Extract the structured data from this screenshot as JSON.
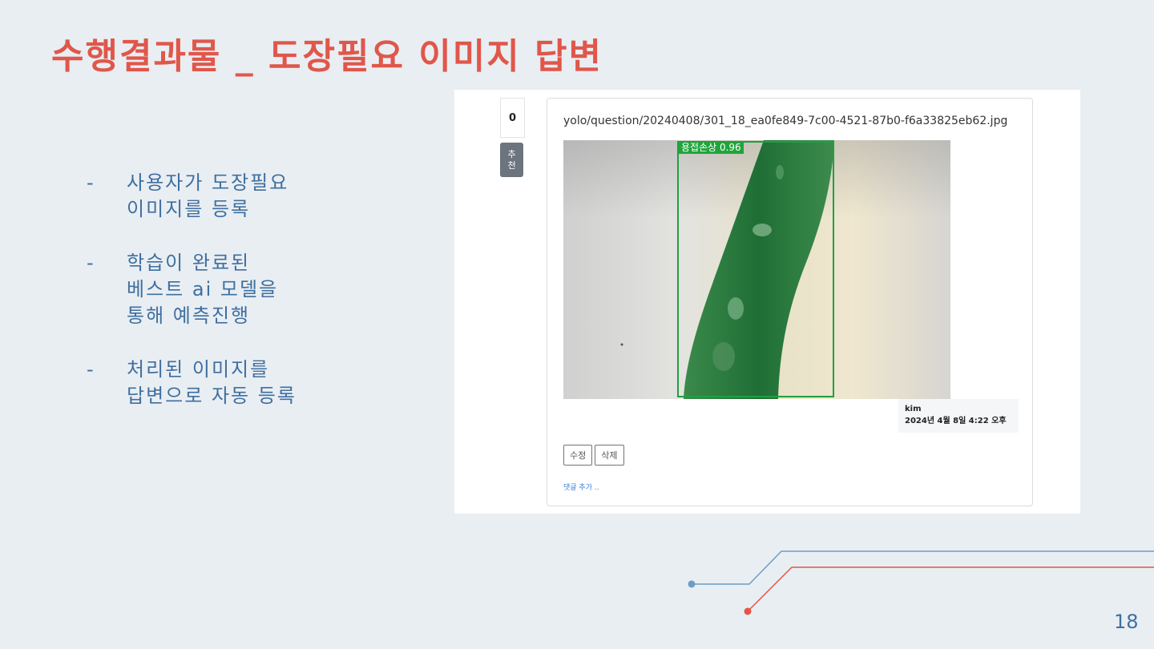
{
  "slide": {
    "title": "수행결과물 _ 도장필요 이미지 답변",
    "page_number": "18",
    "bullets": [
      {
        "dash": "-",
        "text": "사용자가 도장필요\n이미지를 등록"
      },
      {
        "dash": "-",
        "text": "학습이 완료된\n베스트 ai 모델을\n통해 예측진행"
      },
      {
        "dash": "-",
        "text": "처리된 이미지를\n답변으로 자동 등록"
      }
    ]
  },
  "screenshot": {
    "vote_count": "0",
    "recommend_label": "추\n천",
    "file_path": "yolo/question/20240408/301_18_ea0fe849-7c00-4521-87b0-f6a33825eb62.jpg",
    "detection_label": "용접손상 0.96",
    "author": "kim",
    "date": "2024년 4월 8일 4:22 오후",
    "buttons": {
      "edit": "수정",
      "delete": "삭제"
    },
    "add_comment": "댓글 추가 .."
  },
  "colors": {
    "title": "#e0574a",
    "text_blue": "#3f6f9f",
    "line_blue": "#6f9cc6",
    "line_red": "#e0574a",
    "bbox_green": "#20a040"
  }
}
